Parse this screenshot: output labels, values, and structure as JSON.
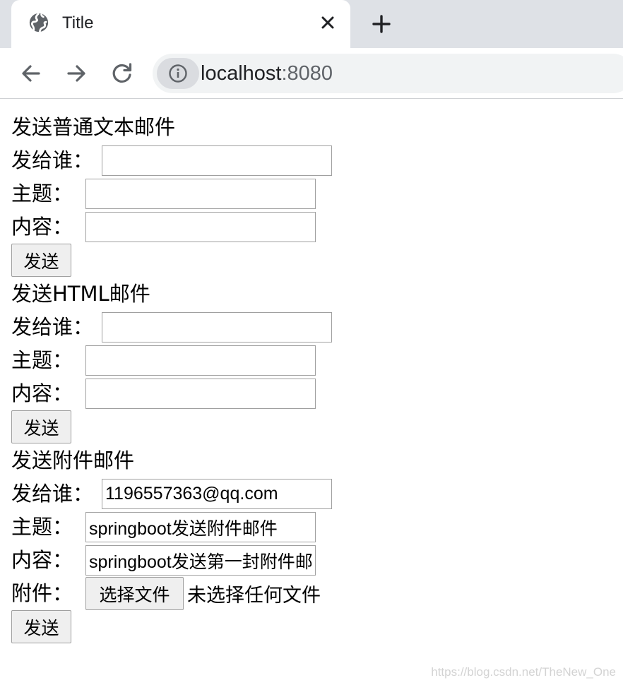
{
  "browser": {
    "tab_title": "Title",
    "url_host": "localhost",
    "url_port": ":8080"
  },
  "sections": [
    {
      "title": "发送普通文本邮件",
      "to_label": "发给谁：",
      "to_value": "",
      "subject_label": "主题：",
      "subject_value": "",
      "content_label": "内容：",
      "content_value": "",
      "send_label": "发送"
    },
    {
      "title": "发送HTML邮件",
      "to_label": "发给谁：",
      "to_value": "",
      "subject_label": "主题：",
      "subject_value": "",
      "content_label": "内容：",
      "content_value": "",
      "send_label": "发送"
    },
    {
      "title": "发送附件邮件",
      "to_label": "发给谁：",
      "to_value": "1196557363@qq.com",
      "subject_label": "主题：",
      "subject_value": "springboot发送附件邮件",
      "content_label": "内容：",
      "content_value": "springboot发送第一封附件邮件",
      "attachment_label": "附件：",
      "choose_file_label": "选择文件",
      "no_file_text": "未选择任何文件",
      "send_label": "发送"
    }
  ],
  "watermark": "https://blog.csdn.net/TheNew_One",
  "icons": {
    "tab": "globe-icon",
    "close": "close-icon",
    "new_tab": "plus-icon",
    "back": "arrow-left-icon",
    "forward": "arrow-right-icon",
    "reload": "reload-icon",
    "site_info": "info-icon"
  }
}
